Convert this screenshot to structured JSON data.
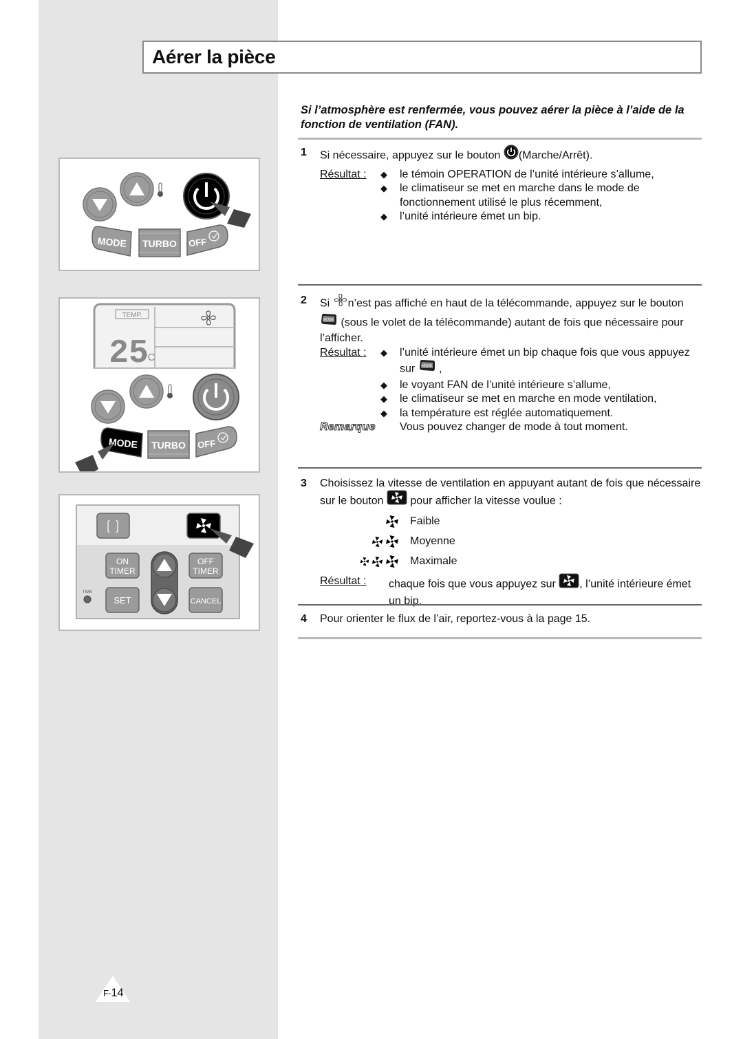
{
  "page": {
    "title": "Aérer la pièce",
    "intro": "Si l’atmosphère est renfermée, vous pouvez aérer la pièce à l’aide de la fonction de ventilation (FAN).",
    "page_number_prefix": "F-",
    "page_number": "14"
  },
  "result_label": "Résultat",
  "result_colon": " :",
  "steps": [
    {
      "number": "1",
      "text_before_icon": "Si nécessaire, appuyez sur le bouton ",
      "icon": "power-icon",
      "text_after_icon": "(Marche/Arrêt).",
      "results": [
        "le témoin OPERATION de l’unité intérieure s’allume,",
        "le climatiseur se met en marche dans le mode de fonctionnement utilisé le plus récemment,",
        "l’unité intérieure émet un bip."
      ]
    },
    {
      "number": "2",
      "text_1": "Si ",
      "icon_1": "fan-outline-icon",
      "text_2": "n’est pas affiché en haut de la télécommande, appuyez sur le bouton ",
      "icon_2": "mode-button-icon",
      "text_3": " (sous le volet de la télécommande) autant de fois que nécessaire pour l’afficher.",
      "results": [
        {
          "text": "l’unité intérieure émet un bip chaque fois que vous appuyez sur ",
          "icon": "mode-button-icon",
          "text_after": " ,"
        },
        {
          "text": "le voyant FAN de l’unité intérieure s’allume,"
        },
        {
          "text": "le climatiseur se met en marche en mode ventilation,"
        },
        {
          "text": "la température est réglée automatiquement."
        }
      ],
      "note_label": "Remarque",
      "note": "Vous pouvez changer de mode à tout moment."
    },
    {
      "number": "3",
      "text_before_icon": "Choisissez la vitesse de ventilation en appuyant autant de fois que nécessaire sur le bouton ",
      "icon": "fan-speed-button-icon",
      "text_after_icon": " pour afficher la vitesse voulue :",
      "speeds": [
        {
          "label": "Faible",
          "level": 1
        },
        {
          "label": "Moyenne",
          "level": 2
        },
        {
          "label": "Maximale",
          "level": 3
        }
      ],
      "result_text_before": "chaque fois que vous appuyez sur ",
      "result_icon": "fan-speed-button-icon",
      "result_text_after": ", l’unité intérieure émet un bip."
    },
    {
      "number": "4",
      "text": "Pour orienter le flux de l’air, reportez-vous à la page 15."
    }
  ],
  "illustrations": {
    "remote_top": {
      "buttons": {
        "mode": "MODE",
        "turbo": "TURBO",
        "off": "OFF"
      },
      "highlighted": "power-button"
    },
    "remote_display": {
      "temp_label": "TEMP.",
      "temperature": "25",
      "unit": "°C",
      "display_icon": "fan-icon",
      "buttons": {
        "mode": "MODE",
        "turbo": "TURBO",
        "off": "OFF"
      },
      "highlighted": "mode-button"
    },
    "remote_flap": {
      "buttons": {
        "on_timer_1": "ON",
        "on_timer_2": "TIMER",
        "off_timer_1": "OFF",
        "off_timer_2": "TIMER",
        "set": "SET",
        "cancel": "CANCEL",
        "time": "TIME"
      },
      "highlighted": "fan-speed-button"
    }
  },
  "colors": {
    "band": "#e5e5e5",
    "rule": "#666666",
    "button_gray": "#9a9a9a",
    "button_dark": "#111111"
  }
}
